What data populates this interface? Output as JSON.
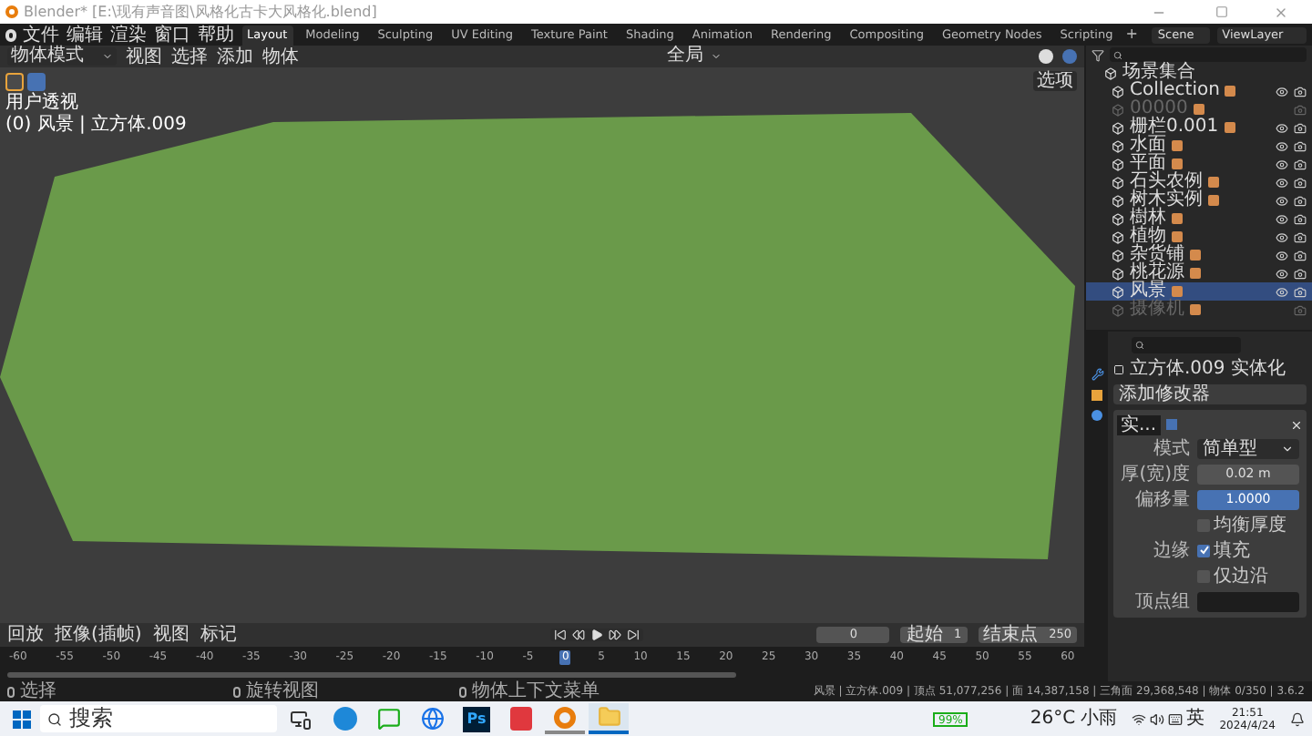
{
  "window": {
    "title": "Blender* [E:\\现有声音图\\风格化古卡大风格化.blend]"
  },
  "menus": [
    "文件",
    "编辑",
    "渲染",
    "窗口",
    "帮助"
  ],
  "workspaces": [
    {
      "label": "Layout",
      "selected": true
    },
    {
      "label": "Modeling",
      "selected": false
    },
    {
      "label": "Sculpting",
      "selected": false
    },
    {
      "label": "UV Editing",
      "selected": false
    },
    {
      "label": "Texture Paint",
      "selected": false
    },
    {
      "label": "Shading",
      "selected": false
    },
    {
      "label": "Animation",
      "selected": false
    },
    {
      "label": "Rendering",
      "selected": false
    },
    {
      "label": "Compositing",
      "selected": false
    },
    {
      "label": "Geometry Nodes",
      "selected": false
    },
    {
      "label": "Scripting",
      "selected": false
    }
  ],
  "add_workspace": "+",
  "scene": "Scene",
  "view_layer": "ViewLayer",
  "viewport_header": {
    "mode": "物体模式",
    "menus": [
      "视图",
      "选择",
      "添加",
      "物体"
    ],
    "orientation": "全局",
    "options": "选项"
  },
  "viewport": {
    "view_name": "用户透视",
    "object_info": "(0) 风景 | 立方体.009"
  },
  "outliner": {
    "root": "场景集合",
    "items": [
      {
        "name": "Collection",
        "disabled": false,
        "selected": false
      },
      {
        "name": "00000",
        "disabled": true,
        "selected": false
      },
      {
        "name": "栅栏0.001",
        "disabled": false,
        "selected": false
      },
      {
        "name": "水面",
        "disabled": false,
        "selected": false
      },
      {
        "name": "平面",
        "disabled": false,
        "selected": false
      },
      {
        "name": "石头农例",
        "disabled": false,
        "selected": false
      },
      {
        "name": "树木实例",
        "disabled": false,
        "selected": false
      },
      {
        "name": "樹林",
        "disabled": false,
        "selected": false
      },
      {
        "name": "植物",
        "disabled": false,
        "selected": false
      },
      {
        "name": "杂货铺",
        "disabled": false,
        "selected": false
      },
      {
        "name": "桃花源",
        "disabled": false,
        "selected": false
      },
      {
        "name": "风景",
        "disabled": false,
        "selected": true
      },
      {
        "name": "摄像机",
        "disabled": true,
        "selected": false
      }
    ]
  },
  "properties": {
    "object": "立方体.009",
    "modifier_path": "实体化",
    "add_modifier": "添加修改器",
    "modifier_name": "实...",
    "fields": [
      {
        "kind": "dropdown",
        "label": "模式",
        "value": "简单型"
      },
      {
        "kind": "number",
        "label": "厚(宽)度",
        "value": "0.02 m"
      },
      {
        "kind": "slider",
        "label": "偏移量",
        "value": "1.0000",
        "level": 1
      },
      {
        "kind": "check",
        "option": "均衡厚度",
        "checked": false
      },
      {
        "kind": "check",
        "label": "边缘",
        "option": "填充",
        "checked": true
      },
      {
        "kind": "check",
        "option": "仅边沿",
        "checked": false
      },
      {
        "kind": "group",
        "label": "顶点组"
      }
    ]
  },
  "timeline": {
    "menus": [
      "回放",
      "抠像(插帧)",
      "视图",
      "标记"
    ],
    "current_frame": "0",
    "start_label": "起始",
    "start": "1",
    "end_label": "结束点",
    "end": "250",
    "ticks": [
      {
        "label": "-60",
        "selected": false
      },
      {
        "label": "-55",
        "selected": false
      },
      {
        "label": "-50",
        "selected": false
      },
      {
        "label": "-45",
        "selected": false
      },
      {
        "label": "-40",
        "selected": false
      },
      {
        "label": "-35",
        "selected": false
      },
      {
        "label": "-30",
        "selected": false
      },
      {
        "label": "-25",
        "selected": false
      },
      {
        "label": "-20",
        "selected": false
      },
      {
        "label": "-15",
        "selected": false
      },
      {
        "label": "-10",
        "selected": false
      },
      {
        "label": "-5",
        "selected": false
      },
      {
        "label": "0",
        "selected": true
      },
      {
        "label": "5",
        "selected": false
      },
      {
        "label": "10",
        "selected": false
      },
      {
        "label": "15",
        "selected": false
      },
      {
        "label": "20",
        "selected": false
      },
      {
        "label": "25",
        "selected": false
      },
      {
        "label": "30",
        "selected": false
      },
      {
        "label": "35",
        "selected": false
      },
      {
        "label": "40",
        "selected": false
      },
      {
        "label": "45",
        "selected": false
      },
      {
        "label": "50",
        "selected": false
      },
      {
        "label": "55",
        "selected": false
      },
      {
        "label": "60",
        "selected": false
      }
    ]
  },
  "status_bar": {
    "hints": [
      "选择",
      "旋转视图",
      "物体上下文菜单"
    ],
    "stats": "风景 | 立方体.009 | 顶点 51,077,256 | 面 14,387,158 | 三角面 29,368,548 | 物体 0/350 | 3.6.2"
  },
  "taskbar": {
    "search": "搜索",
    "apps": [
      {
        "kind": "taskview"
      },
      {
        "kind": "edge"
      },
      {
        "kind": "chat"
      },
      {
        "kind": "browser"
      },
      {
        "kind": "photoshop",
        "label": "Ps"
      },
      {
        "kind": "acrobat"
      },
      {
        "kind": "blender"
      },
      {
        "kind": "folder"
      }
    ],
    "battery": "99%",
    "weather": "26°C 小雨",
    "ime": "英",
    "time": "21:51",
    "date": "2024/4/24"
  }
}
